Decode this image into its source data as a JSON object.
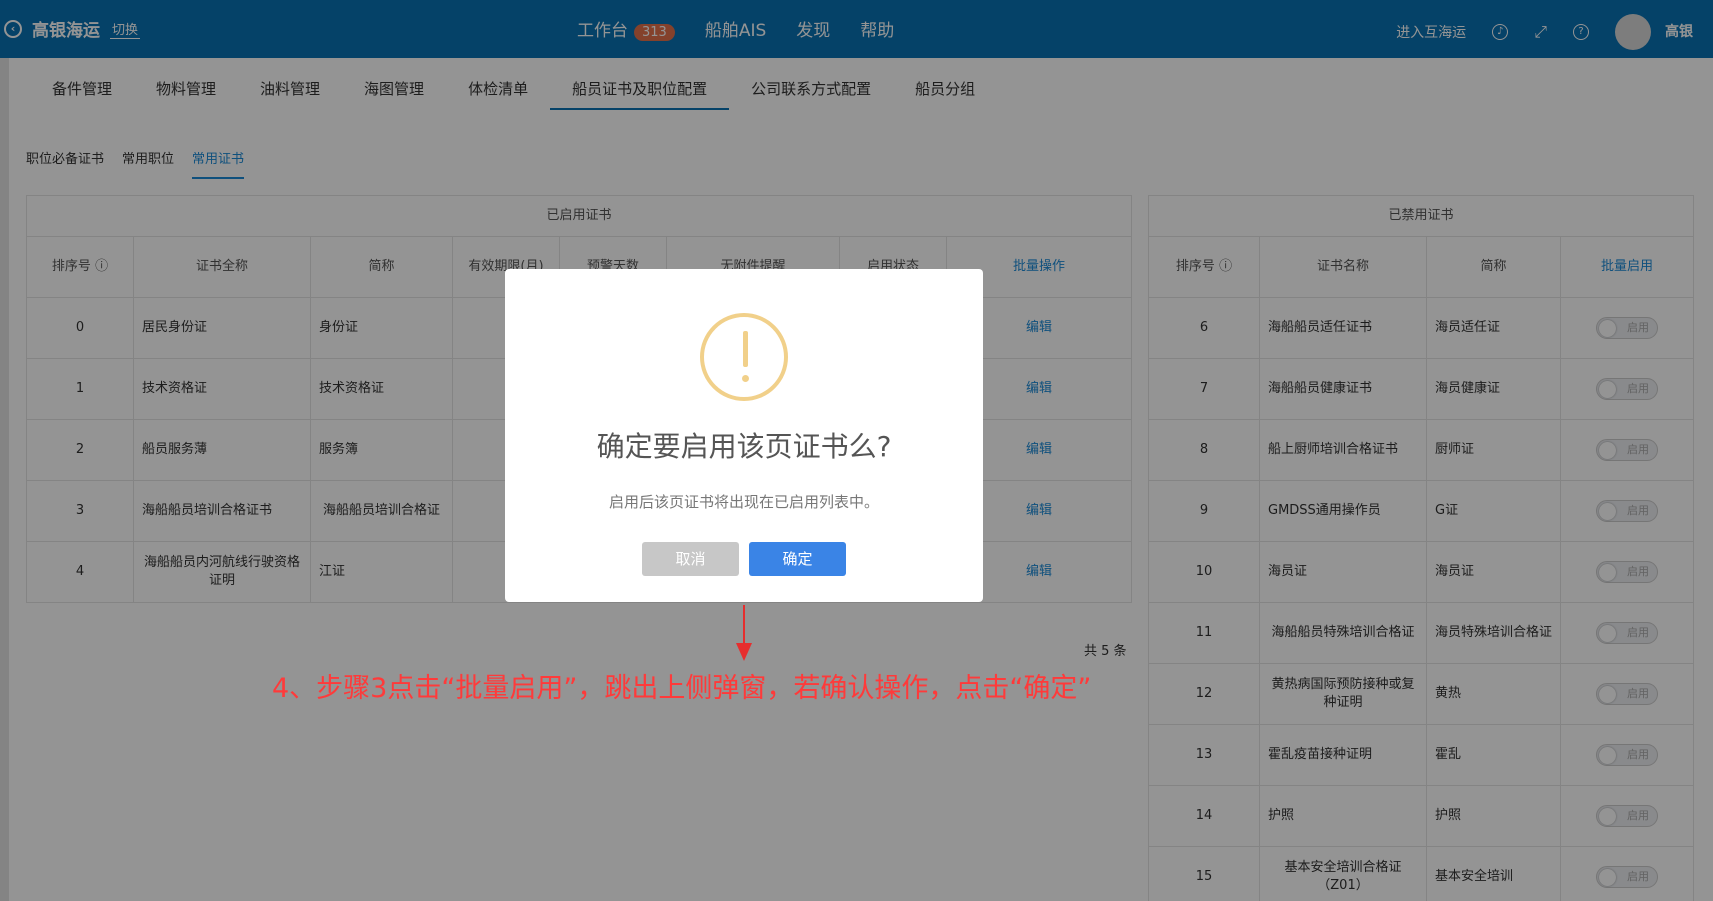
{
  "header": {
    "brand": "高银海运",
    "switch": "切换",
    "nav": [
      "工作台",
      "船舶AIS",
      "发现",
      "帮助"
    ],
    "workbench_badge": "313",
    "enter": "进入互海运",
    "user": "高银"
  },
  "tabs": [
    "备件管理",
    "物料管理",
    "油料管理",
    "海图管理",
    "体检清单",
    "船员证书及职位配置",
    "公司联系方式配置",
    "船员分组"
  ],
  "subtabs": [
    "职位必备证书",
    "常用职位",
    "常用证书"
  ],
  "enabled": {
    "title": "已启用证书",
    "headers": [
      "排序号",
      "证书全称",
      "简称",
      "有效期限(月)",
      "预警天数",
      "无附件提醒",
      "启用状态",
      "批量操作"
    ],
    "edit": "编辑",
    "rows": [
      {
        "no": "0",
        "name": "居民身份证",
        "short": "身份证"
      },
      {
        "no": "1",
        "name": "技术资格证",
        "short": "技术资格证"
      },
      {
        "no": "2",
        "name": "船员服务薄",
        "short": "服务簿"
      },
      {
        "no": "3",
        "name": "海船船员培训合格证书",
        "short": "海船船员培训合格证"
      },
      {
        "no": "4",
        "name": "海船船员内河航线行驶资格证明",
        "short": "江证"
      }
    ],
    "total": "共 5 条"
  },
  "disabled": {
    "title": "已禁用证书",
    "headers": [
      "排序号",
      "证书名称",
      "简称",
      "批量启用"
    ],
    "toggle": "启用",
    "rows": [
      {
        "no": "6",
        "name": "海船船员适任证书",
        "short": "海员适任证"
      },
      {
        "no": "7",
        "name": "海船船员健康证书",
        "short": "海员健康证"
      },
      {
        "no": "8",
        "name": "船上厨师培训合格证书",
        "short": "厨师证"
      },
      {
        "no": "9",
        "name": "GMDSS通用操作员",
        "short": "G证"
      },
      {
        "no": "10",
        "name": "海员证",
        "short": "海员证"
      },
      {
        "no": "11",
        "name": "海船船员特殊培训合格证",
        "short": "海员特殊培训合格证"
      },
      {
        "no": "12",
        "name": "黄热病国际预防接种或复种证明",
        "short": "黄热"
      },
      {
        "no": "13",
        "name": "霍乱疫苗接种证明",
        "short": "霍乱"
      },
      {
        "no": "14",
        "name": "护照",
        "short": "护照"
      },
      {
        "no": "15",
        "name": "基本安全培训合格证（Z01）",
        "short": "基本安全培训"
      }
    ]
  },
  "modal": {
    "title": "确定要启用该页证书么?",
    "text": "启用后该页证书将出现在已启用列表中。",
    "cancel": "取消",
    "ok": "确定"
  },
  "annotation": "4、步骤3点击“批量启用”，跳出上侧弹窗，若确认操作，点击“确定”"
}
